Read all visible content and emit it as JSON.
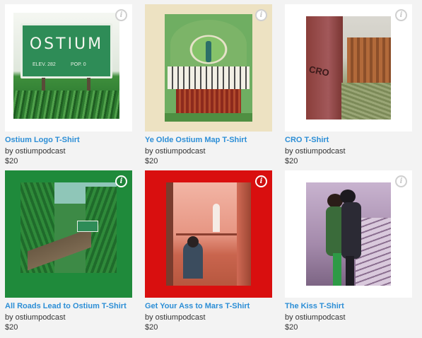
{
  "products": [
    {
      "title": "Ostium Logo T-Shirt",
      "by": "by ostiumpodcast",
      "price": "$20",
      "thumb_bg": "#ffffff",
      "info_style": "light"
    },
    {
      "title": "Ye Olde Ostium Map T-Shirt",
      "by": "by ostiumpodcast",
      "price": "$20",
      "thumb_bg": "#ede2c2",
      "info_style": "light"
    },
    {
      "title": "CRO T-Shirt",
      "by": "by ostiumpodcast",
      "price": "$20",
      "thumb_bg": "#ffffff",
      "info_style": "light"
    },
    {
      "title": "All Roads Lead to Ostium T-Shirt",
      "by": "by ostiumpodcast",
      "price": "$20",
      "thumb_bg": "#1f8a3b",
      "info_style": "dark"
    },
    {
      "title": "Get Your Ass to Mars T-Shirt",
      "by": "by ostiumpodcast",
      "price": "$20",
      "thumb_bg": "#d90f0f",
      "info_style": "dark"
    },
    {
      "title": "The Kiss T-Shirt",
      "by": "by ostiumpodcast",
      "price": "$20",
      "thumb_bg": "#ffffff",
      "info_style": "light"
    }
  ],
  "sign": {
    "name": "OSTIUM",
    "elev": "ELEV. 282",
    "pop": "POP. 0"
  },
  "cro_carving": "CRO",
  "info_glyph": "i",
  "colors": {
    "link": "#2c8ed6",
    "page_bg": "#f3f3f3"
  }
}
